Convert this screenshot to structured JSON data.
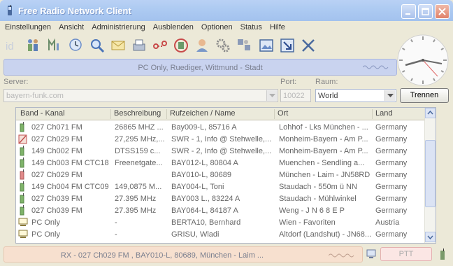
{
  "window": {
    "title": "Free Radio Network Client"
  },
  "menu": [
    "Einstellungen",
    "Ansicht",
    "Administrierung",
    "Ausblenden",
    "Optionen",
    "Status",
    "Hilfe"
  ],
  "station": {
    "text": "PC Only, Ruediger, Wittmund - Stadt"
  },
  "server": {
    "label": "Server:",
    "value": "bayern-funk.com"
  },
  "port": {
    "label": "Port:",
    "value": "10022"
  },
  "raum": {
    "label": "Raum:",
    "value": "World"
  },
  "disconnect_button": {
    "label": "Trennen"
  },
  "table": {
    "columns": [
      "Band - Kanal",
      "Beschreibung",
      "Rufzeichen / Name",
      "Ort",
      "Land"
    ],
    "rows": [
      {
        "icon": "radio-green",
        "band": "027 Ch071 FM",
        "desc": "26865 MHZ ...",
        "call": "Bay009-L, 85716 A",
        "ort": "Lohhof - Lks München - ...",
        "land": "Germany"
      },
      {
        "icon": "radio-blocked",
        "band": "027 Ch029 FM",
        "desc": "27,295 MHz,...",
        "call": "SWR - 1, Info @ Stehwelle,...",
        "ort": "Monheim-Bayern - Am P...",
        "land": "Germany"
      },
      {
        "icon": "radio-green",
        "band": "149 Ch002 FM",
        "desc": "DTSS159 c...",
        "call": "SWR - 2, Info @ Stehwelle,...",
        "ort": "Monheim-Bayern - Am P...",
        "land": "Germany"
      },
      {
        "icon": "radio-green",
        "band": "149 Ch003 FM CTC18",
        "desc": "Freenetgate...",
        "call": "BAY012-L, 80804 A",
        "ort": "Muenchen - Sendling a...",
        "land": "Germany"
      },
      {
        "icon": "radio-red",
        "band": "027 Ch029 FM",
        "desc": "",
        "call": "BAY010-L, 80689",
        "ort": "München - Laim - JN58RD",
        "land": "Germany"
      },
      {
        "icon": "radio-green",
        "band": "149 Ch004 FM CTC09",
        "desc": "149,0875 M...",
        "call": "BAY004-L, Toni",
        "ort": "Staudach - 550m ü NN",
        "land": "Germany"
      },
      {
        "icon": "radio-green",
        "band": "027 Ch039 FM",
        "desc": "27.395 MHz",
        "call": "BAY003 L., 83224 A",
        "ort": "Staudach - Mühlwinkel",
        "land": "Germany"
      },
      {
        "icon": "radio-green",
        "band": "027 Ch039 FM",
        "desc": "27.395 MHz",
        "call": "BAY064-L, 84187 A",
        "ort": "Weng - J N 6 8 E P",
        "land": "Germany"
      },
      {
        "icon": "pc",
        "band": "PC Only",
        "desc": "-",
        "call": "BERTA10, Bernhard",
        "ort": "Wien - Favoriten",
        "land": "Austria"
      },
      {
        "icon": "pc",
        "band": "PC Only",
        "desc": "-",
        "call": "GRISU, Wladi",
        "ort": "Altdorf (Landshut) - JN68...",
        "land": "Germany"
      }
    ]
  },
  "rx": {
    "text": "RX - 027 Ch029 FM , BAY010-L, 80689, München - Laim ..."
  },
  "ptt": {
    "label": "PTT"
  }
}
